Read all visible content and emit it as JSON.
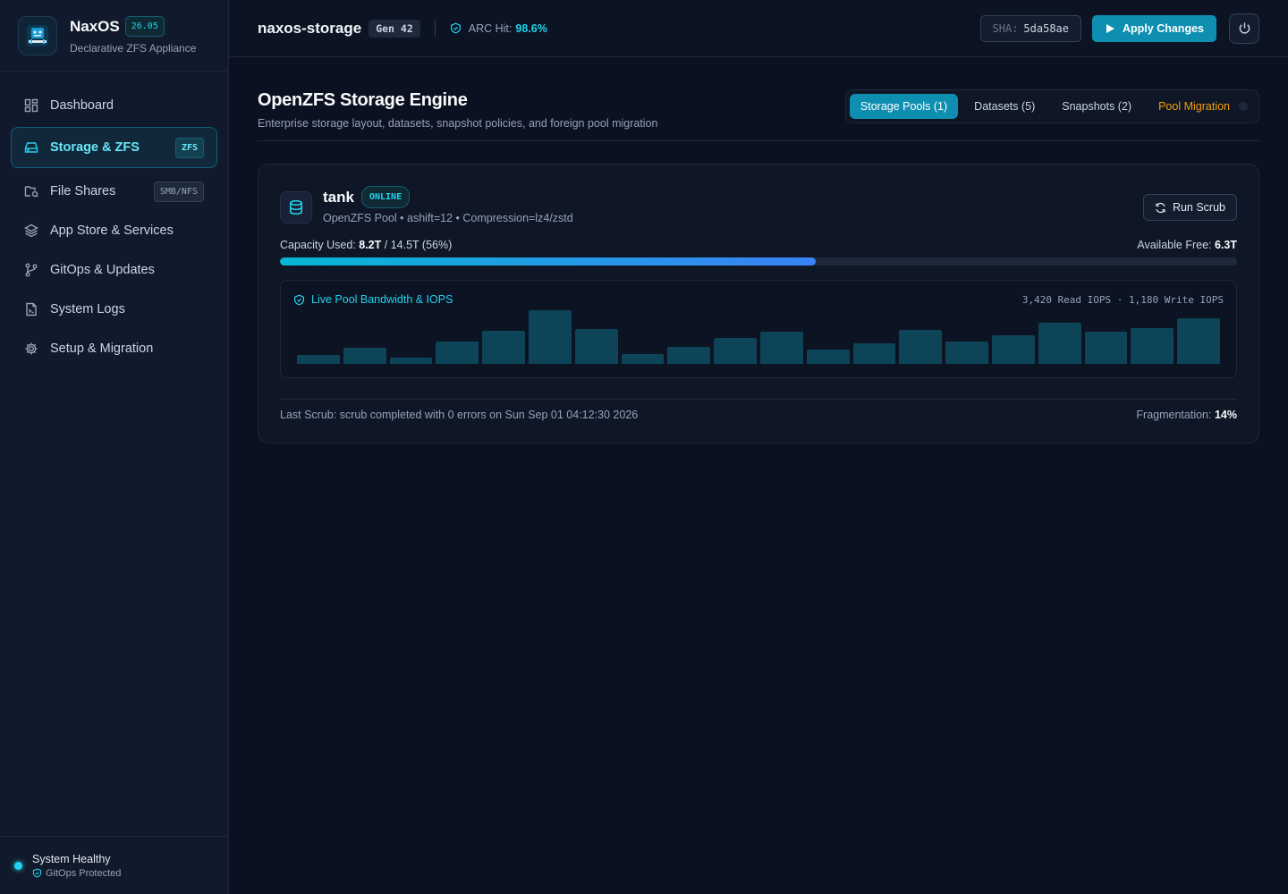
{
  "brand": {
    "name": "NaxOS",
    "version": "26.05",
    "subtitle": "Declarative ZFS Appliance"
  },
  "sidebar": {
    "items": [
      {
        "label": "Dashboard",
        "icon": "dashboard-icon",
        "badge": ""
      },
      {
        "label": "Storage & ZFS",
        "icon": "hard-drive-icon",
        "badge": "ZFS",
        "active": true
      },
      {
        "label": "File Shares",
        "icon": "folder-share-icon",
        "badge": "SMB/NFS"
      },
      {
        "label": "App Store & Services",
        "icon": "layers-icon",
        "badge": ""
      },
      {
        "label": "GitOps & Updates",
        "icon": "git-branch-icon",
        "badge": ""
      },
      {
        "label": "System Logs",
        "icon": "file-log-icon",
        "badge": ""
      },
      {
        "label": "Setup & Migration",
        "icon": "gear-icon",
        "badge": ""
      }
    ],
    "status": {
      "title": "System Healthy",
      "subtitle": "GitOps Protected"
    }
  },
  "topbar": {
    "hostname": "naxos-storage",
    "generation": "Gen 42",
    "arc_label": "ARC Hit:",
    "arc_value": "98.6%",
    "sha_label": "SHA:",
    "sha_value": "5da58ae",
    "apply_label": "Apply Changes"
  },
  "page": {
    "title": "OpenZFS Storage Engine",
    "subtitle": "Enterprise storage layout, datasets, snapshot policies, and foreign pool migration",
    "tabs": [
      {
        "label": "Storage Pools (1)",
        "active": true
      },
      {
        "label": "Datasets (5)"
      },
      {
        "label": "Snapshots (2)"
      },
      {
        "label": "Pool Migration",
        "warning": true
      }
    ]
  },
  "pool": {
    "name": "tank",
    "state": "ONLINE",
    "meta": "OpenZFS Pool • ashift=12 • Compression=lz4/zstd",
    "scrub_button": "Run Scrub",
    "capacity_label": "Capacity Used:",
    "capacity_used": "8.2T",
    "capacity_total": "/ 14.5T (56%)",
    "capacity_fraction": 0.56,
    "free_label": "Available Free:",
    "free_value": "6.3T",
    "bandwidth": {
      "title": "Live Pool Bandwidth & IOPS",
      "stats": "3,420 Read IOPS · 1,180 Write IOPS",
      "levels": [
        0.16,
        0.3,
        0.12,
        0.42,
        0.62,
        1.0,
        0.65,
        0.19,
        0.32,
        0.48,
        0.6,
        0.26,
        0.38,
        0.64,
        0.41,
        0.53,
        0.77,
        0.6,
        0.66,
        0.85
      ]
    },
    "last_scrub": "Last Scrub: scrub completed with 0 errors on Sun Sep 01 04:12:30 2026",
    "fragmentation_label": "Fragmentation:",
    "fragmentation_value": "14%"
  },
  "colors": {
    "accent": "#22d3ee",
    "primary_button": "#0e8fb1",
    "warning": "#f59e0b",
    "background": "#0b1120"
  }
}
